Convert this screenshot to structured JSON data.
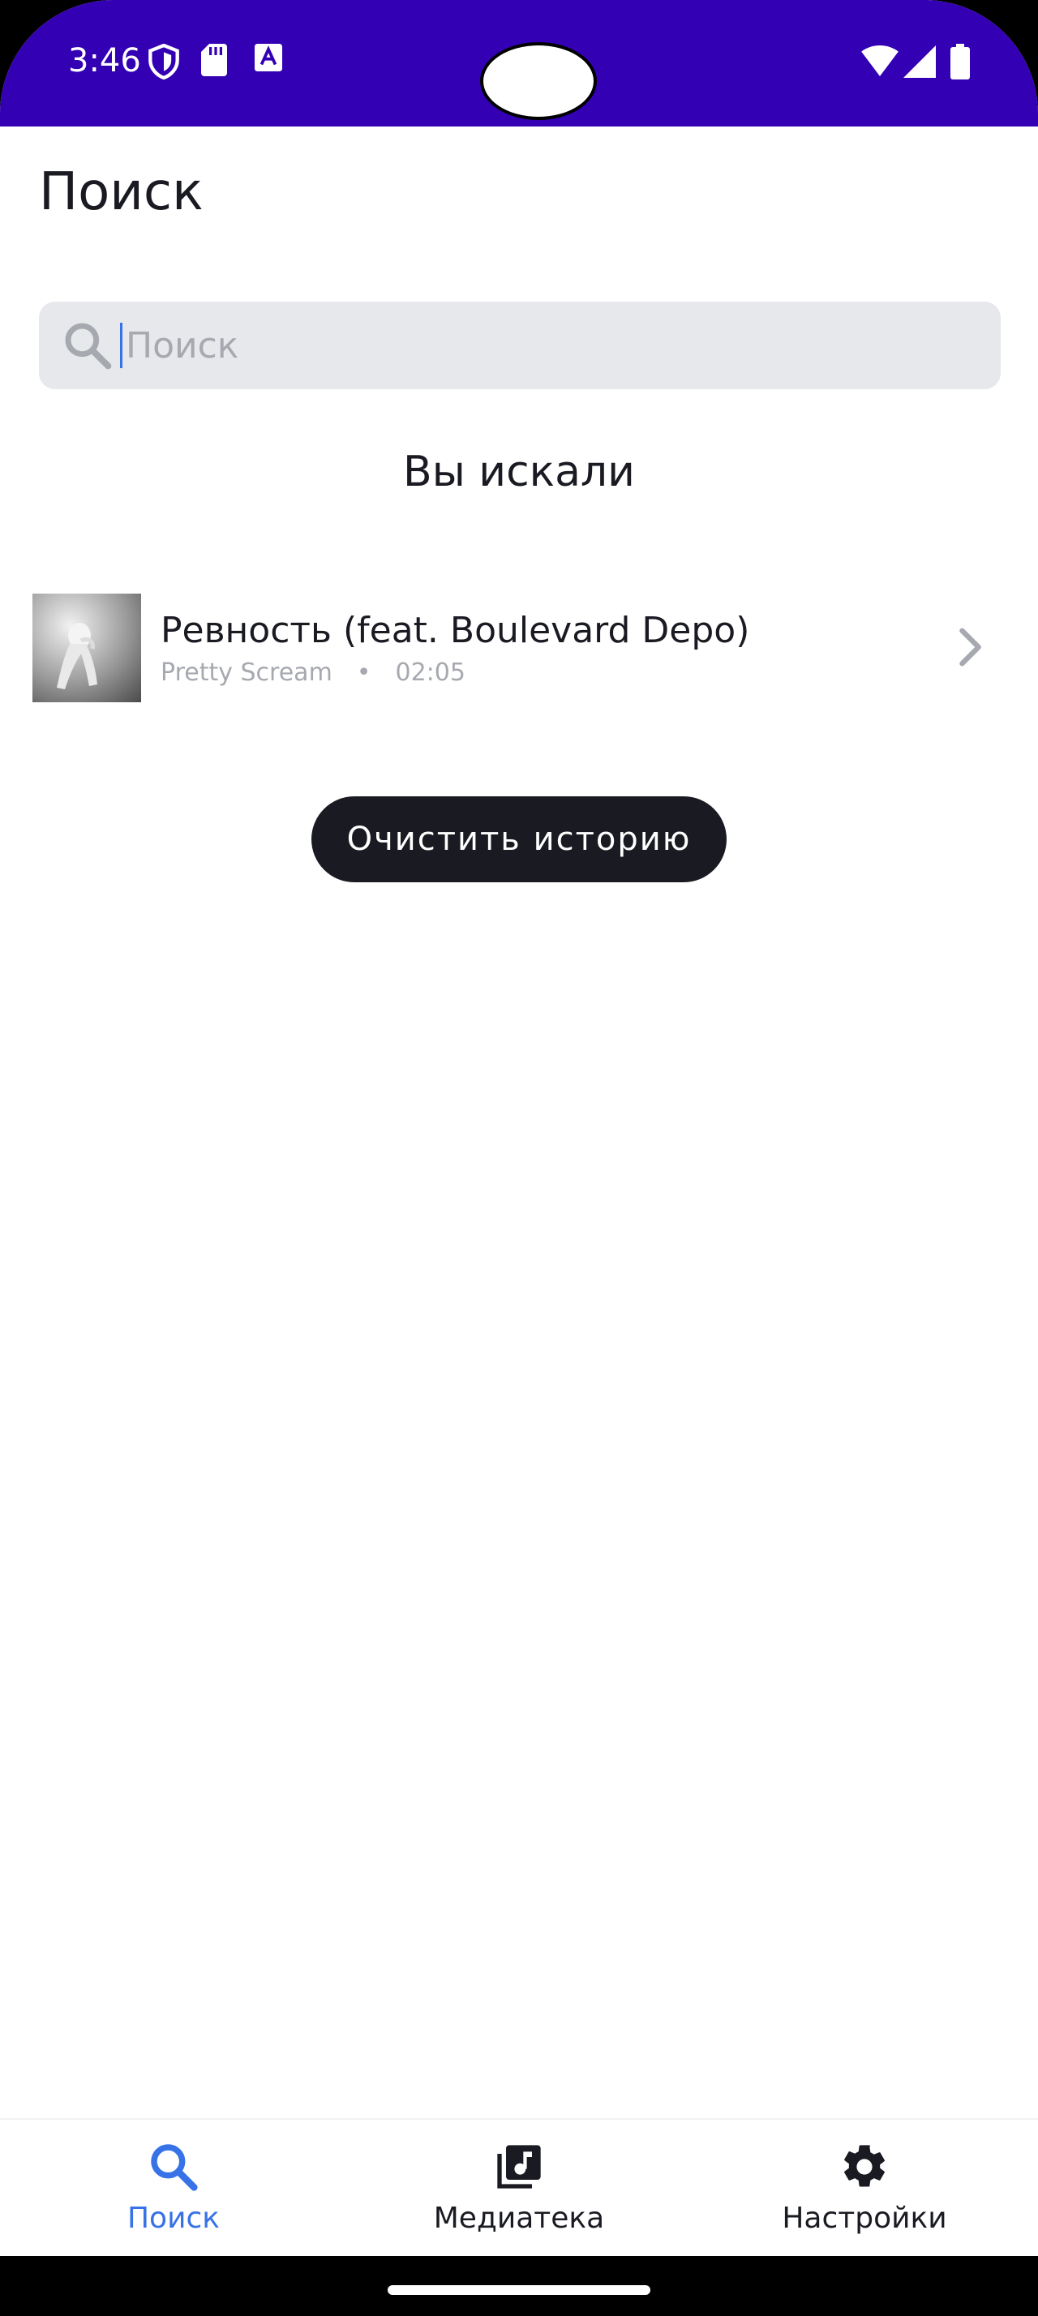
{
  "status_bar": {
    "time": "3:46",
    "icons_left": [
      "shield-icon",
      "sd-card-icon",
      "font-a-icon"
    ],
    "icons_right": [
      "wifi-icon",
      "signal-icon",
      "battery-icon"
    ],
    "background": "#3300b3"
  },
  "header": {
    "title": "Поиск"
  },
  "search": {
    "placeholder": "Поиск",
    "value": ""
  },
  "history": {
    "heading": "Вы искали",
    "items": [
      {
        "title": "Ревность (feat. Boulevard Depo)",
        "artist": "Pretty Scream",
        "separator": "•",
        "duration": "02:05"
      }
    ],
    "clear_button": "Очистить историю"
  },
  "bottom_nav": {
    "items": [
      {
        "label": "Поиск",
        "icon": "search-icon",
        "active": true
      },
      {
        "label": "Медиатека",
        "icon": "library-music-icon",
        "active": false
      },
      {
        "label": "Настройки",
        "icon": "gear-icon",
        "active": false
      }
    ]
  },
  "colors": {
    "accent": "#3772e7",
    "text_primary": "#1a1b22",
    "text_secondary": "#a7a9b0",
    "search_bg": "#e6e8eb"
  }
}
